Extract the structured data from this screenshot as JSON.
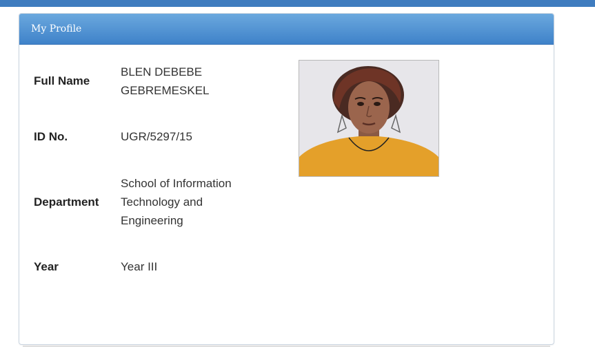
{
  "panel": {
    "title": "My Profile"
  },
  "profile": {
    "full_name_label": "Full Name",
    "full_name_line1": "BLEN DEBEBE",
    "full_name_line2": "GEBREMESKEL",
    "id_label": "ID No.",
    "id_value": "UGR/5297/15",
    "department_label": "Department",
    "department_line1": "School of Information",
    "department_line2": "Technology and",
    "department_line3": "Engineering",
    "year_label": "Year",
    "year_value": "Year III"
  },
  "photo": {
    "icon": "profile-photo"
  },
  "colors": {
    "header_gradient_top": "#6aa8de",
    "header_gradient_bottom": "#3f82c9",
    "top_bar": "#3f7cbf"
  }
}
